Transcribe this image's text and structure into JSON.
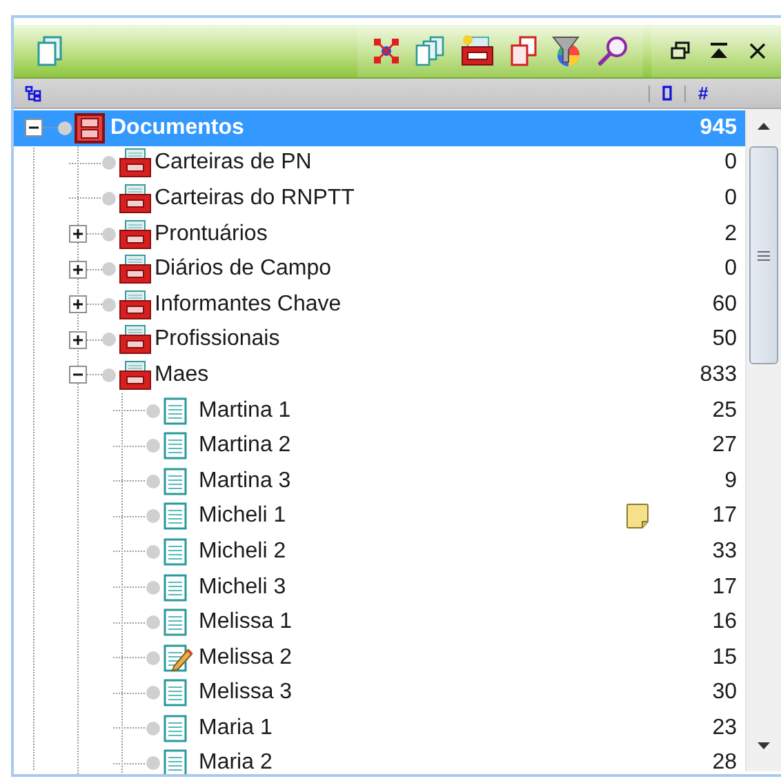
{
  "header": {
    "count_heading": "#"
  },
  "tree": [
    {
      "label": "Documentos",
      "count": "945",
      "kind": "archive",
      "selected": true,
      "expanded": true,
      "children": [
        {
          "label": "Carteiras de PN",
          "count": "0",
          "kind": "cabinet",
          "selected": false
        },
        {
          "label": "Carteiras do RNPTT",
          "count": "0",
          "kind": "cabinet",
          "selected": false
        },
        {
          "label": "Prontuários",
          "count": "2",
          "kind": "cabinet",
          "selected": false,
          "expanded": false
        },
        {
          "label": "Diários de Campo",
          "count": "0",
          "kind": "cabinet",
          "selected": false,
          "expanded": false
        },
        {
          "label": "Informantes Chave",
          "count": "60",
          "kind": "cabinet",
          "selected": false,
          "expanded": false
        },
        {
          "label": "Profissionais",
          "count": "50",
          "kind": "cabinet",
          "selected": false,
          "expanded": false
        },
        {
          "label": "Maes",
          "count": "833",
          "kind": "cabinet",
          "selected": false,
          "expanded": true,
          "children": [
            {
              "label": "Martina 1",
              "count": "25",
              "kind": "document",
              "selected": false,
              "memo": false,
              "edited": false
            },
            {
              "label": "Martina 2",
              "count": "27",
              "kind": "document",
              "selected": false,
              "memo": false,
              "edited": false
            },
            {
              "label": "Martina 3",
              "count": "9",
              "kind": "document",
              "selected": false,
              "memo": false,
              "edited": false
            },
            {
              "label": "Micheli 1",
              "count": "17",
              "kind": "document",
              "selected": false,
              "memo": true,
              "edited": false
            },
            {
              "label": "Micheli 2",
              "count": "33",
              "kind": "document",
              "selected": false,
              "memo": false,
              "edited": false
            },
            {
              "label": "Micheli 3",
              "count": "17",
              "kind": "document",
              "selected": false,
              "memo": false,
              "edited": false
            },
            {
              "label": "Melissa 1",
              "count": "16",
              "kind": "document",
              "selected": false,
              "memo": false,
              "edited": false
            },
            {
              "label": "Melissa 2",
              "count": "15",
              "kind": "document",
              "selected": false,
              "memo": false,
              "edited": true
            },
            {
              "label": "Melissa 3",
              "count": "30",
              "kind": "document",
              "selected": false,
              "memo": false,
              "edited": false
            },
            {
              "label": "Maria 1",
              "count": "23",
              "kind": "document",
              "selected": false,
              "memo": false,
              "edited": false
            },
            {
              "label": "Maria 2",
              "count": "28",
              "kind": "document",
              "selected": false,
              "memo": false,
              "edited": false
            }
          ]
        }
      ]
    }
  ]
}
